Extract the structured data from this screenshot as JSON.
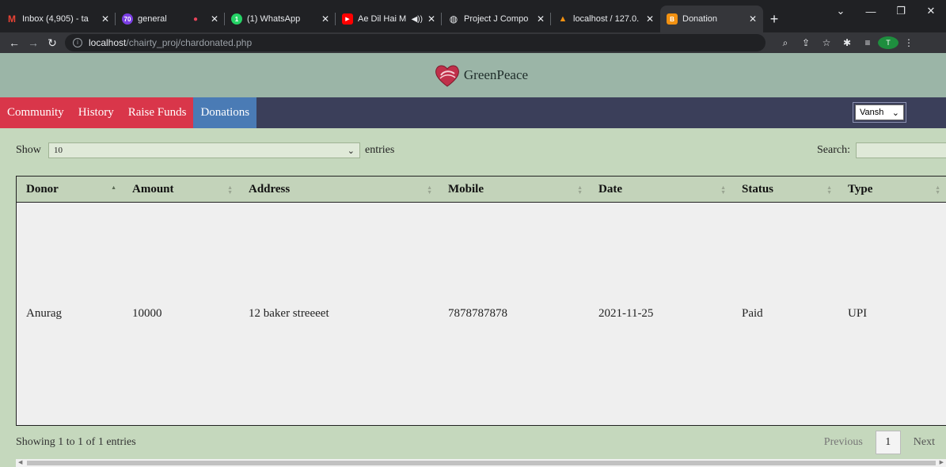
{
  "browser": {
    "tabs": [
      {
        "title": "Inbox (4,905) - ta",
        "color": "#ea4335",
        "glyph": "M",
        "closable": true
      },
      {
        "title": "general",
        "color": "#7b3fe4",
        "glyph": "70",
        "closable": false
      },
      {
        "title": "",
        "color": "#e8445a",
        "glyph": "●",
        "closable": true
      },
      {
        "title": "(1) WhatsApp",
        "color": "#25d366",
        "glyph": "1",
        "closable": true
      },
      {
        "title": "Ae Dil Hai M",
        "color": "#ff0000",
        "glyph": "▶",
        "closable": true,
        "audio": true
      },
      {
        "title": "Project J Compo",
        "color": "#5f6368",
        "glyph": "◐",
        "closable": true
      },
      {
        "title": "localhost / 127.0.",
        "color": "#f29111",
        "glyph": "▲",
        "closable": true
      },
      {
        "title": "Donation",
        "color": "#f29111",
        "glyph": "B",
        "closable": true,
        "active": true
      }
    ],
    "url_host": "localhost",
    "url_path": "/chairty_proj/chardonated.php"
  },
  "header": {
    "brand": "GreenPeace",
    "logo_color": "#c0304a"
  },
  "menu": {
    "items": [
      "Community",
      "History",
      "Raise Funds"
    ],
    "active": "Donations",
    "user": "Vansh"
  },
  "controls": {
    "show_label": "Show",
    "length_value": "10",
    "entries_label": "entries",
    "search_label": "Search:",
    "search_value": ""
  },
  "table": {
    "columns": [
      "Donor",
      "Amount",
      "Address",
      "Mobile",
      "Date",
      "Status",
      "Type"
    ],
    "rows": [
      [
        "Anurag",
        "10000",
        "12 baker streeeet",
        "7878787878",
        "2021-11-25",
        "Paid",
        "UPI"
      ]
    ]
  },
  "footer": {
    "info": "Showing 1 to 1 of 1 entries",
    "previous": "Previous",
    "page": "1",
    "next": "Next"
  }
}
